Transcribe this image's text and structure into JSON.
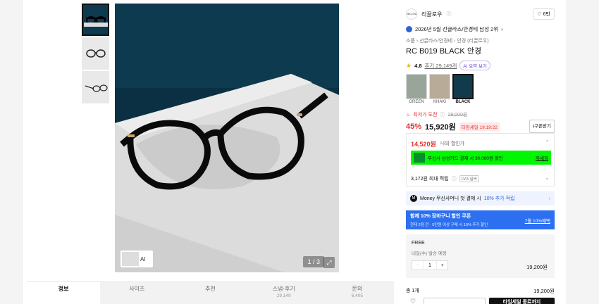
{
  "brand": {
    "logo_text": "RECLOW",
    "name": "리끌로우",
    "likes": "6만"
  },
  "rank_text": "2026년 5월 선글라스/안경테 남성 2위",
  "breadcrumb": "소품 › 선글라스/안경테 › 안경 (리끌로우)",
  "product_title": "RC B019 BLACK 안경",
  "rating": {
    "score": "4.8",
    "reviews": "후기 29,149개",
    "ai_chip": "AI 요약 보기"
  },
  "colors": [
    {
      "label": "GREEN"
    },
    {
      "label": "KHAKI"
    },
    {
      "label": "BLACK",
      "selected": true
    }
  ],
  "lowest": {
    "label": "최저가 도전",
    "original": "29,000원"
  },
  "price": {
    "discount": "45%",
    "current": "15,920원",
    "timer": "타임세일 19:19:22",
    "coupon": "쿠폰받기"
  },
  "my_price": {
    "amount": "14,520원",
    "label": "나의 할인가"
  },
  "promo": {
    "text": "무신사 삼성카드 결제 시 30,000원 할인",
    "link": "자세히"
  },
  "points": {
    "text": "3,172원 최대 적립",
    "level": "LV.5 실버"
  },
  "money": {
    "badge": "M",
    "text_a": "Money 무신사머니 첫 결제 시",
    "text_b": "10% 추가 적립"
  },
  "banner": {
    "line1": "함께 10% 장바구니 할인 쿠폰",
    "line2": "현재 2점 전 · 5만원 이상 구매 시 10% 추가 할인",
    "link": "7월 10%혜택"
  },
  "option": {
    "name": "FREE",
    "delivery": "내일(수) 발송 예정",
    "qty": "1",
    "minus": "−",
    "plus": "+",
    "price": "19,200원"
  },
  "total": {
    "label": "총 1개",
    "price": "19,200원"
  },
  "buy_button": "타임세일 종료까지",
  "gallery": {
    "pager": "1 / 3",
    "ai_label": "AI",
    "zoom": "⤢"
  },
  "tabs": [
    {
      "label": "정보",
      "active": true
    },
    {
      "label": "사이즈"
    },
    {
      "label": "추천"
    },
    {
      "label": "스냅·후기",
      "count": "29,149"
    },
    {
      "label": "문의",
      "count": "6,405"
    }
  ]
}
